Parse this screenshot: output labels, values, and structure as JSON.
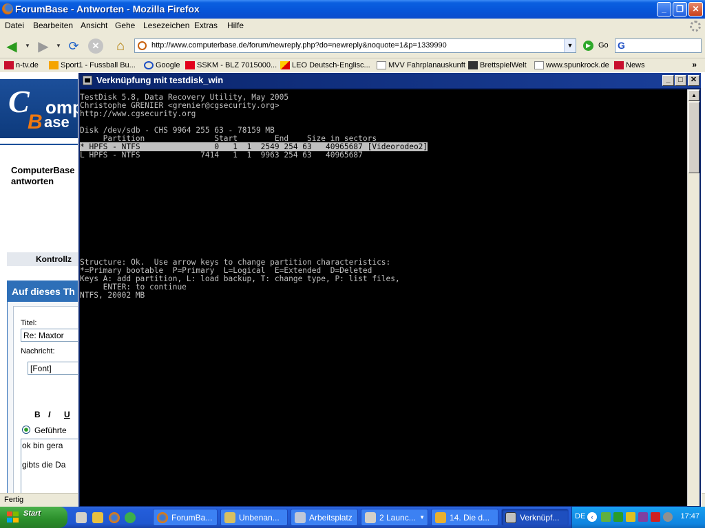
{
  "firefox": {
    "title": "ForumBase - Antworten - Mozilla Firefox",
    "menu": [
      "Datei",
      "Bearbeiten",
      "Ansicht",
      "Gehe",
      "Lesezeichen",
      "Extras",
      "Hilfe"
    ],
    "url": "http://www.computerbase.de/forum/newreply.php?do=newreply&noquote=1&p=1339990",
    "go_label": "Go",
    "bookmarks": [
      "n-tv.de",
      "Sport1 - Fussball Bu...",
      "Google",
      "SSKM - BLZ 7015000...",
      "LEO Deutsch-Englisc...",
      "MVV Fahrplanauskunft",
      "BrettspielWelt",
      "www.spunkrock.de",
      "News"
    ],
    "status": "Fertig"
  },
  "page": {
    "logo_c": "C",
    "logo_omput": "omput",
    "logo_b": "B",
    "logo_ase": "ase",
    "title_line1": "ComputerBase",
    "title_line2": "antworten",
    "kontroll": "Kontrollz",
    "reply_heading": "Auf dieses Th",
    "titel_label": "Titel:",
    "titel_value": "Re: Maxtor",
    "nachricht_label": "Nachricht:",
    "font_select": "[Font]",
    "fmt_bold": "B",
    "fmt_italic": "I",
    "fmt_underline": "U",
    "radio_label": "Geführte",
    "msg_line1": "ok bin gera",
    "msg_line2": "gibts die Da"
  },
  "console": {
    "title": "Verknüpfung mit testdisk_win",
    "lines_top": [
      "TestDisk 5.8, Data Recovery Utility, May 2005",
      "Christophe GRENIER <grenier@cgsecurity.org>",
      "http://www.cgsecurity.org",
      "",
      "Disk /dev/sdb - CHS 9964 255 63 - 78159 MB",
      "     Partition               Start        End    Size in sectors"
    ],
    "selected_line": "* HPFS - NTFS                0   1  1  2549 254 63   40965687 [Videorodeo2]",
    "lines_mid": [
      "L HPFS - NTFS             7414   1  1  9963 254 63   40965687"
    ],
    "lines_bottom": [
      "Structure: Ok.  Use arrow keys to change partition characteristics:",
      "*=Primary bootable  P=Primary  L=Logical  E=Extended  D=Deleted",
      "Keys A: add partition, L: load backup, T: change type, P: list files,",
      "     ENTER: to continue",
      "NTFS, 20002 MB"
    ]
  },
  "taskbar": {
    "start": "Start",
    "buttons": [
      "ForumBa...",
      "Unbenan...",
      "Arbeitsplatz",
      "2 Launc...",
      "14. Die d...",
      "Verknüpf..."
    ],
    "lang": "DE",
    "clock": "17:47"
  },
  "colors": {
    "xp_blue": "#0654d8",
    "console_bg": "#000000",
    "console_fg": "#c0c0c0",
    "start_green": "#2b8f2b"
  }
}
